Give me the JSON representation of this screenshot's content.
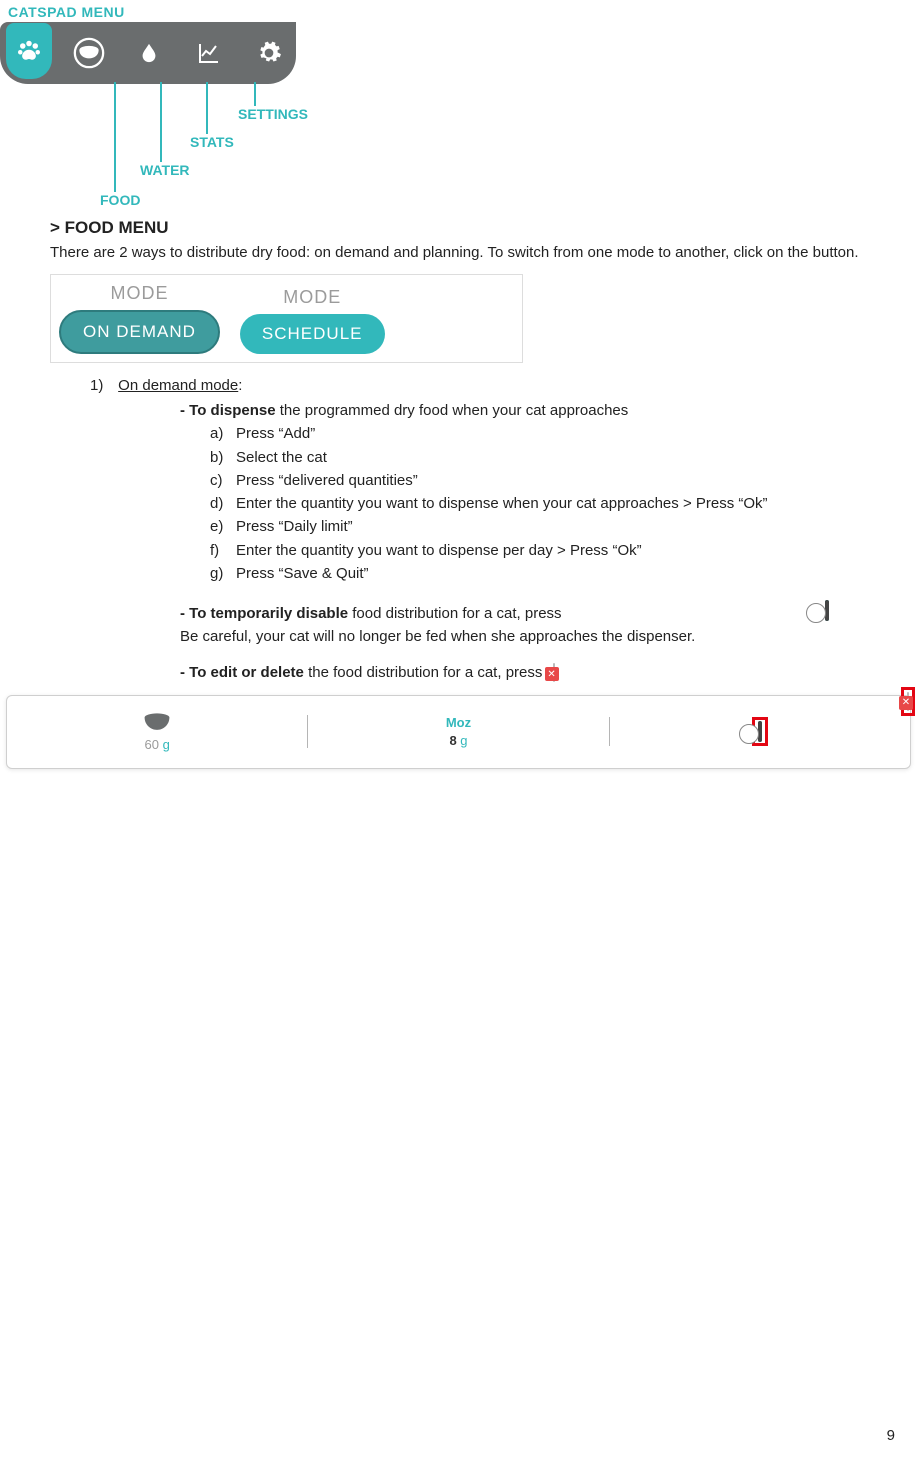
{
  "page_number": "9",
  "menu": {
    "title": "CATSPAD MENU",
    "labels": {
      "food": "FOOD",
      "water": "WATER",
      "stats": "STATS",
      "settings": "SETTINGS"
    }
  },
  "section": {
    "heading": "> FOOD MENU",
    "intro": "There are 2 ways to distribute dry food: on demand and planning. To switch from one mode to another, click on the button."
  },
  "modes": {
    "label": "MODE",
    "on_demand": "ON DEMAND",
    "schedule": "SCHEDULE"
  },
  "ondemand": {
    "num": "1)",
    "title": "On demand mode",
    "colon": ":",
    "dispense_lead_bold": "- To dispense",
    "dispense_lead_rest": " the programmed dry food when your cat approaches",
    "steps": {
      "a": "Press “Add”",
      "b": "Select the cat",
      "c": "Press “delivered quantities”",
      "d": "Enter the quantity you want to dispense when your cat approaches > Press “Ok”",
      "e": "Press “Daily limit”",
      "f": "Enter the quantity you want to dispense per day > Press “Ok”",
      "g": "Press “Save & Quit”"
    },
    "disable_bold": "- To temporarily disable",
    "disable_rest": " food distribution for a cat, press",
    "disable_warn": "Be careful, your cat will no longer be fed when she approaches the dispenser.",
    "edit_bold": "- To edit or delete",
    "edit_rest": " the food distribution for a cat, press"
  },
  "card": {
    "left_amount": "60",
    "left_unit": " g",
    "cat_name": "Moz",
    "right_amount": "8",
    "right_unit": " g"
  }
}
